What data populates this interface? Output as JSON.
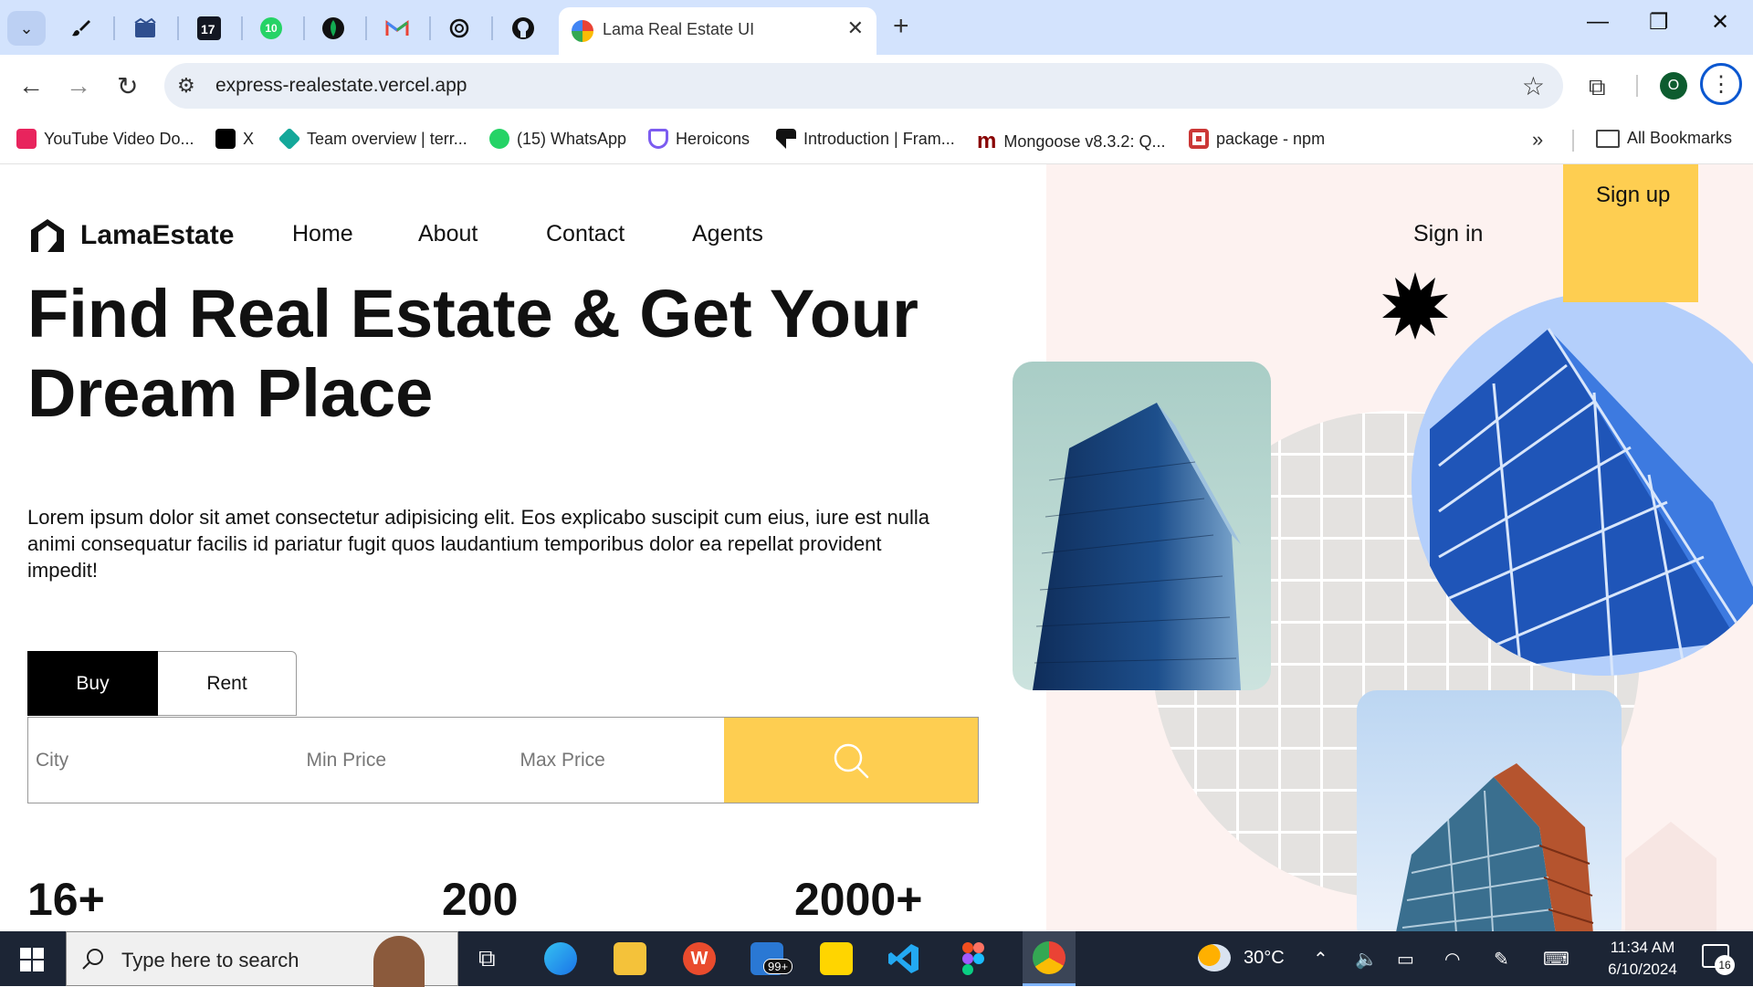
{
  "browser": {
    "active_tab": {
      "title": "Lama Real Estate UI"
    },
    "url": "express-realestate.vercel.app",
    "profile_initial": "O",
    "pinned_badge": "10",
    "bookmarks": [
      {
        "label": "YouTube Video Do...",
        "color": "#e8245d"
      },
      {
        "label": "X",
        "color": "#000000"
      },
      {
        "label": "Team overview | terr...",
        "color": "#14a89a"
      },
      {
        "label": "(15) WhatsApp",
        "color": "#25d366"
      },
      {
        "label": "Heroicons",
        "color": "#7c5cf0"
      },
      {
        "label": "Introduction | Fram...",
        "color": "#111111"
      },
      {
        "label": "Mongoose v8.3.2: Q...",
        "color": "#880000"
      },
      {
        "label": "package - npm",
        "color": "#cb3837"
      }
    ],
    "all_bookmarks": "All Bookmarks"
  },
  "site": {
    "logo": "LamaEstate",
    "nav": [
      "Home",
      "About",
      "Contact",
      "Agents"
    ],
    "sign_in": "Sign in",
    "sign_up": "Sign up",
    "hero_title": "Find Real Estate & Get Your Dream Place",
    "hero_desc": "Lorem ipsum dolor sit amet consectetur adipisicing elit. Eos explicabo suscipit cum eius, iure est nulla animi consequatur facilis id pariatur fugit quos laudantium temporibus dolor ea repellat provident impedit!",
    "tabs": {
      "buy": "Buy",
      "rent": "Rent",
      "selected": "Buy"
    },
    "search": {
      "city_placeholder": "City",
      "min_placeholder": "Min Price",
      "max_placeholder": "Max Price"
    },
    "stats": [
      "16+",
      "200",
      "2000+"
    ],
    "accent": "#fece51"
  },
  "taskbar": {
    "search_placeholder": "Type here to search",
    "mail_badge": "99+",
    "weather": "30°C",
    "time": "11:34 AM",
    "date": "6/10/2024",
    "notifications": "16"
  }
}
